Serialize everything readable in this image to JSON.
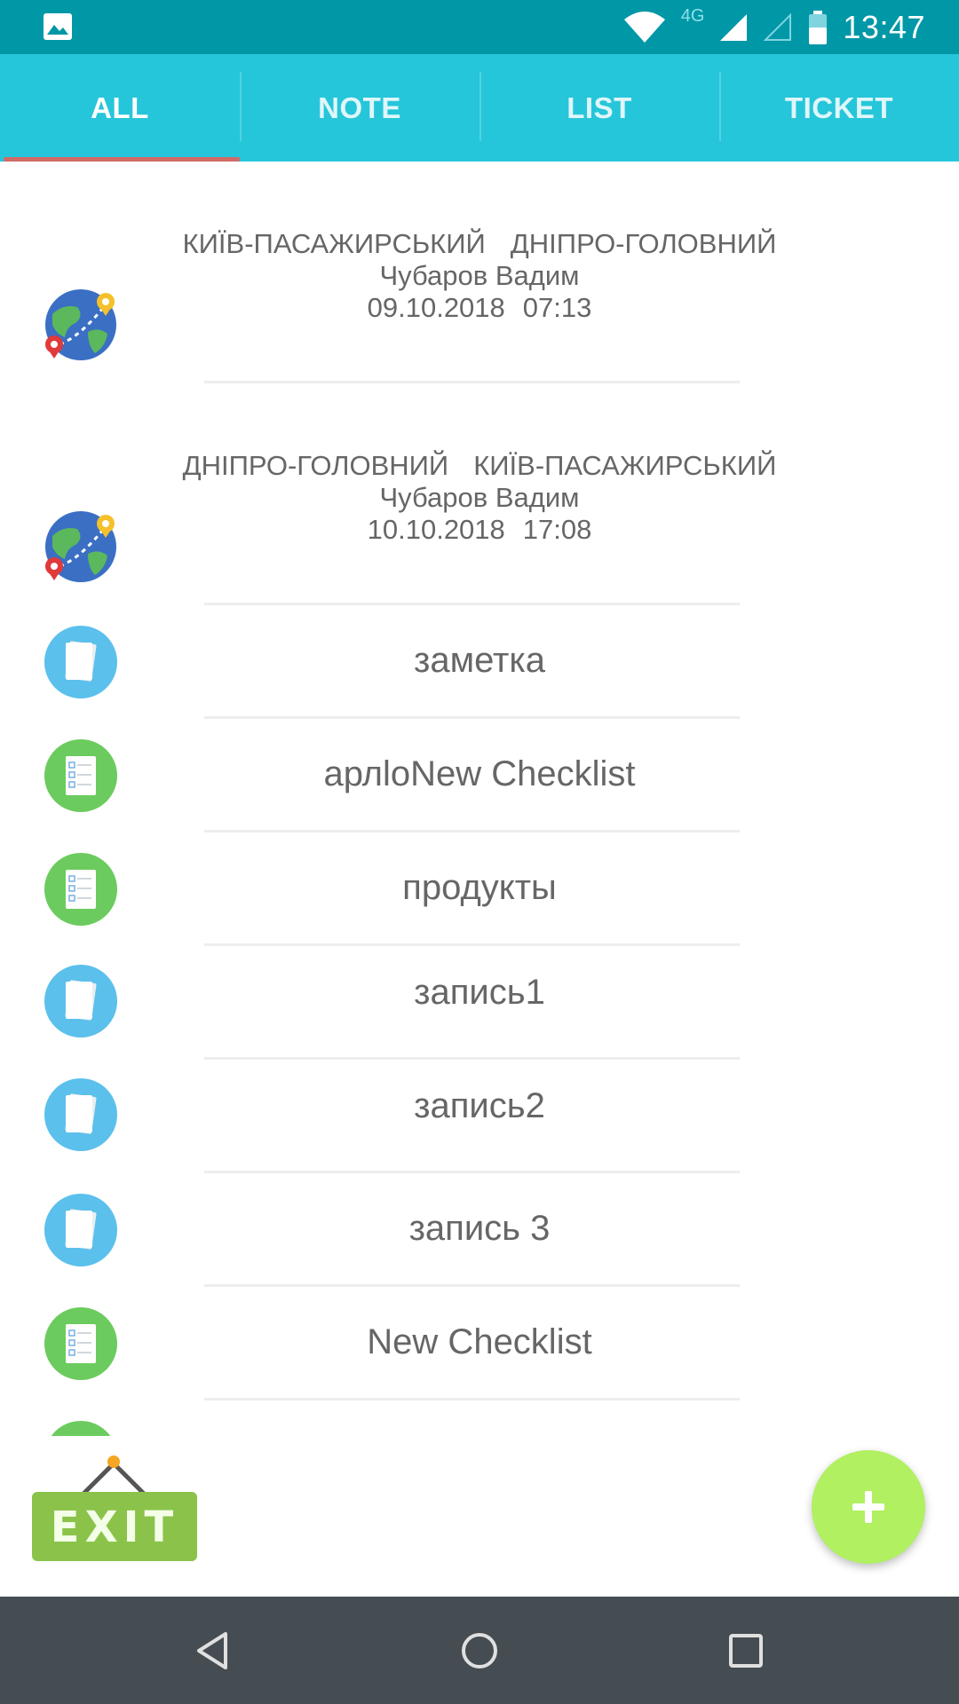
{
  "status_bar": {
    "time": "13:47",
    "network": "4G"
  },
  "tabs": [
    {
      "label": "ALL",
      "active": true
    },
    {
      "label": "NOTE",
      "active": false
    },
    {
      "label": "LIST",
      "active": false
    },
    {
      "label": "TICKET",
      "active": false
    }
  ],
  "items": [
    {
      "type": "ticket",
      "from": "КИЇВ-ПАСАЖИРСЬКИЙ",
      "to": "ДНІПРО-ГОЛОВНИЙ",
      "name": "Чубаров Вадим",
      "date": "09.10.2018",
      "time": "07:13",
      "icon": "globe-route-icon"
    },
    {
      "type": "ticket",
      "from": "ДНІПРО-ГОЛОВНИЙ",
      "to": "КИЇВ-ПАСАЖИРСЬКИЙ",
      "name": "Чубаров Вадим",
      "date": "10.10.2018",
      "time": "17:08",
      "icon": "globe-route-icon"
    },
    {
      "type": "note",
      "title": "заметка",
      "icon": "note-icon"
    },
    {
      "type": "list",
      "title": "арлloNew Checklist",
      "icon": "checklist-icon"
    },
    {
      "type": "list",
      "title": "продукты",
      "icon": "checklist-icon"
    },
    {
      "type": "note",
      "title": "запись1",
      "icon": "note-icon"
    },
    {
      "type": "note",
      "title": "запись2",
      "icon": "note-icon"
    },
    {
      "type": "note",
      "title": "запись 3",
      "icon": "note-icon"
    },
    {
      "type": "list",
      "title": "New Checklist",
      "icon": "checklist-icon"
    }
  ],
  "exit_label": "EXIT",
  "colors": {
    "status_bar": "#0097a7",
    "tab_bar": "#26c6da",
    "tab_indicator": "#d26a66",
    "note_icon": "#5bc0eb",
    "checklist_icon": "#6ccb5f",
    "fab": "#b0f061",
    "exit_sign": "#8bc34a",
    "nav_bar": "#454c52"
  }
}
